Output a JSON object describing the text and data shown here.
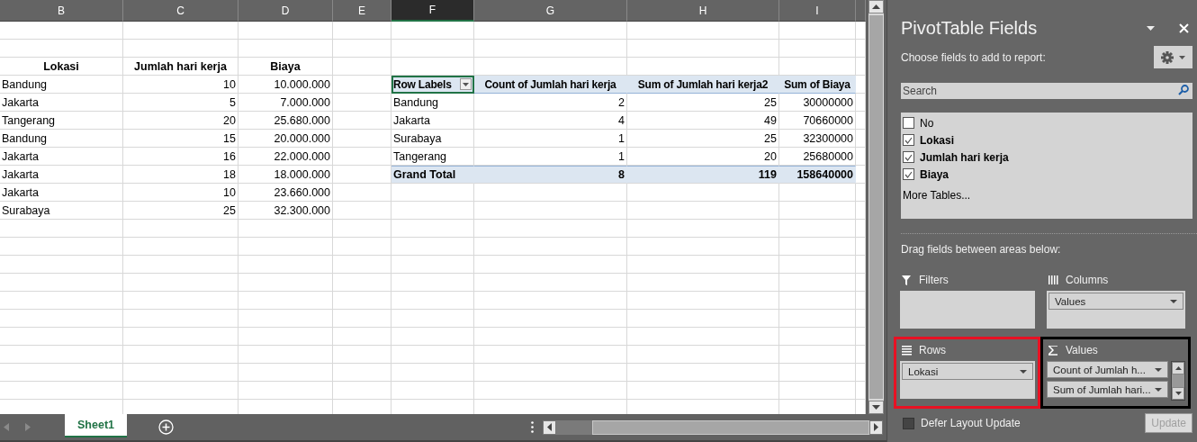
{
  "column_headers": [
    {
      "label": "B",
      "selected": false
    },
    {
      "label": "C",
      "selected": false
    },
    {
      "label": "D",
      "selected": false
    },
    {
      "label": "E",
      "selected": false
    },
    {
      "label": "F",
      "selected": true
    },
    {
      "label": "G",
      "selected": false
    },
    {
      "label": "H",
      "selected": false
    },
    {
      "label": "I",
      "selected": false
    }
  ],
  "source_table": {
    "columns": [
      "Lokasi",
      "Jumlah hari kerja",
      "Biaya"
    ],
    "rows": [
      [
        "Bandung",
        "10",
        "10.000.000"
      ],
      [
        "Jakarta",
        "5",
        "7.000.000"
      ],
      [
        "Tangerang",
        "20",
        "25.680.000"
      ],
      [
        "Bandung",
        "15",
        "20.000.000"
      ],
      [
        "Jakarta",
        "16",
        "22.000.000"
      ],
      [
        "Jakarta",
        "18",
        "18.000.000"
      ],
      [
        "Jakarta",
        "10",
        "23.660.000"
      ],
      [
        "Surabaya",
        "25",
        "32.300.000"
      ]
    ]
  },
  "pivot_table": {
    "columns": [
      {
        "label": "Row Labels",
        "selected": true
      },
      {
        "label": "Count of Jumlah hari kerja",
        "selected": false
      },
      {
        "label": "Sum of Jumlah hari kerja2",
        "selected": false
      },
      {
        "label": "Sum of Biaya",
        "selected": false
      }
    ],
    "rows": [
      [
        "Bandung",
        "2",
        "25",
        "30000000"
      ],
      [
        "Jakarta",
        "4",
        "49",
        "70660000"
      ],
      [
        "Surabaya",
        "1",
        "25",
        "32300000"
      ],
      [
        "Tangerang",
        "1",
        "20",
        "25680000"
      ]
    ],
    "grand_total": [
      "Grand Total",
      "8",
      "119",
      "158640000"
    ]
  },
  "sheet_tabs": [
    {
      "label": "Sheet1",
      "selected": true
    }
  ],
  "field_list": {
    "title": "PivotTable Fields",
    "subtitle": "Choose fields to add to report:",
    "search": {
      "placeholder": "Search"
    },
    "fields": [
      {
        "label": "No",
        "checked": false
      },
      {
        "label": "Lokasi",
        "checked": true
      },
      {
        "label": "Jumlah hari kerja",
        "checked": true
      },
      {
        "label": "Biaya",
        "checked": true
      }
    ],
    "more_tables": "More Tables...",
    "areas_hint": "Drag fields between areas below:",
    "areas": [
      {
        "kind": "filters",
        "label": "Filters"
      },
      {
        "kind": "columns",
        "label": "Columns",
        "items": [
          "Values"
        ]
      },
      {
        "kind": "rows",
        "label": "Rows",
        "color": "#e81123",
        "items": [
          "Lokasi"
        ]
      },
      {
        "kind": "values",
        "label": "Values",
        "color": "#000000",
        "items": [
          "Count of Jumlah h...",
          "Sum of Jumlah hari..."
        ]
      }
    ],
    "defer_layout_update": {
      "label": "Defer Layout Update",
      "checked": false
    },
    "update_button": {
      "label": "Update",
      "disabled": true
    }
  }
}
